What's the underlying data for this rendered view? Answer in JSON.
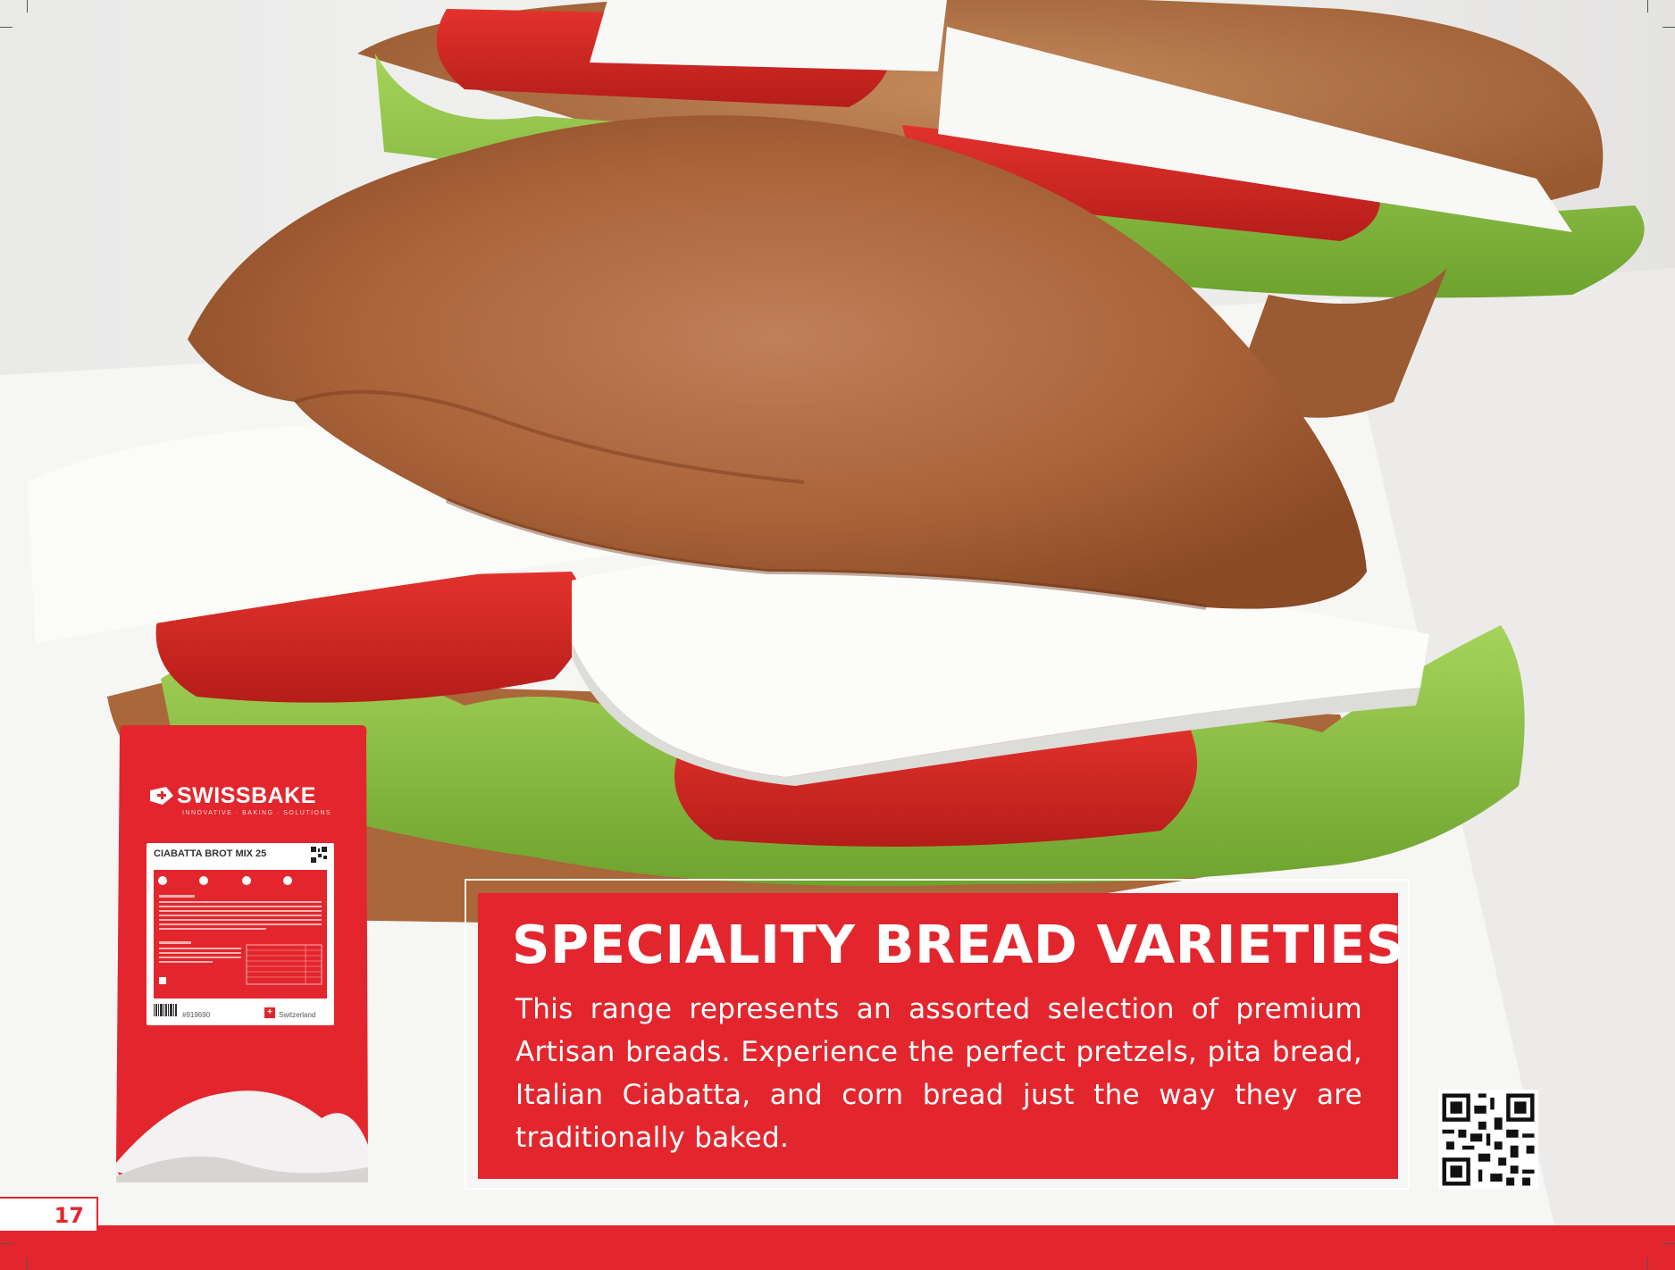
{
  "page": {
    "number": "17",
    "accent_color": "#e3262d"
  },
  "product_bag": {
    "brand": "SWISSBAKE",
    "tagline": "INNOVATIVE · BAKING · SOLUTIONS",
    "product_name": "CIABATTA BROT MIX 25",
    "product_code": "#919690",
    "origin": "Switzerland"
  },
  "feature": {
    "headline": "SPECIALITY BREAD VARIETIES",
    "body": "This range represents an assorted selection of premium Artisan breads. Experience the perfect pretzels, pita bread, Italian Ciabatta, and corn bread just the way they are traditionally baked."
  },
  "icons": {
    "qr": "qr-code-icon",
    "logo": "swissbake-logo-icon",
    "flag": "swiss-flag-icon"
  }
}
